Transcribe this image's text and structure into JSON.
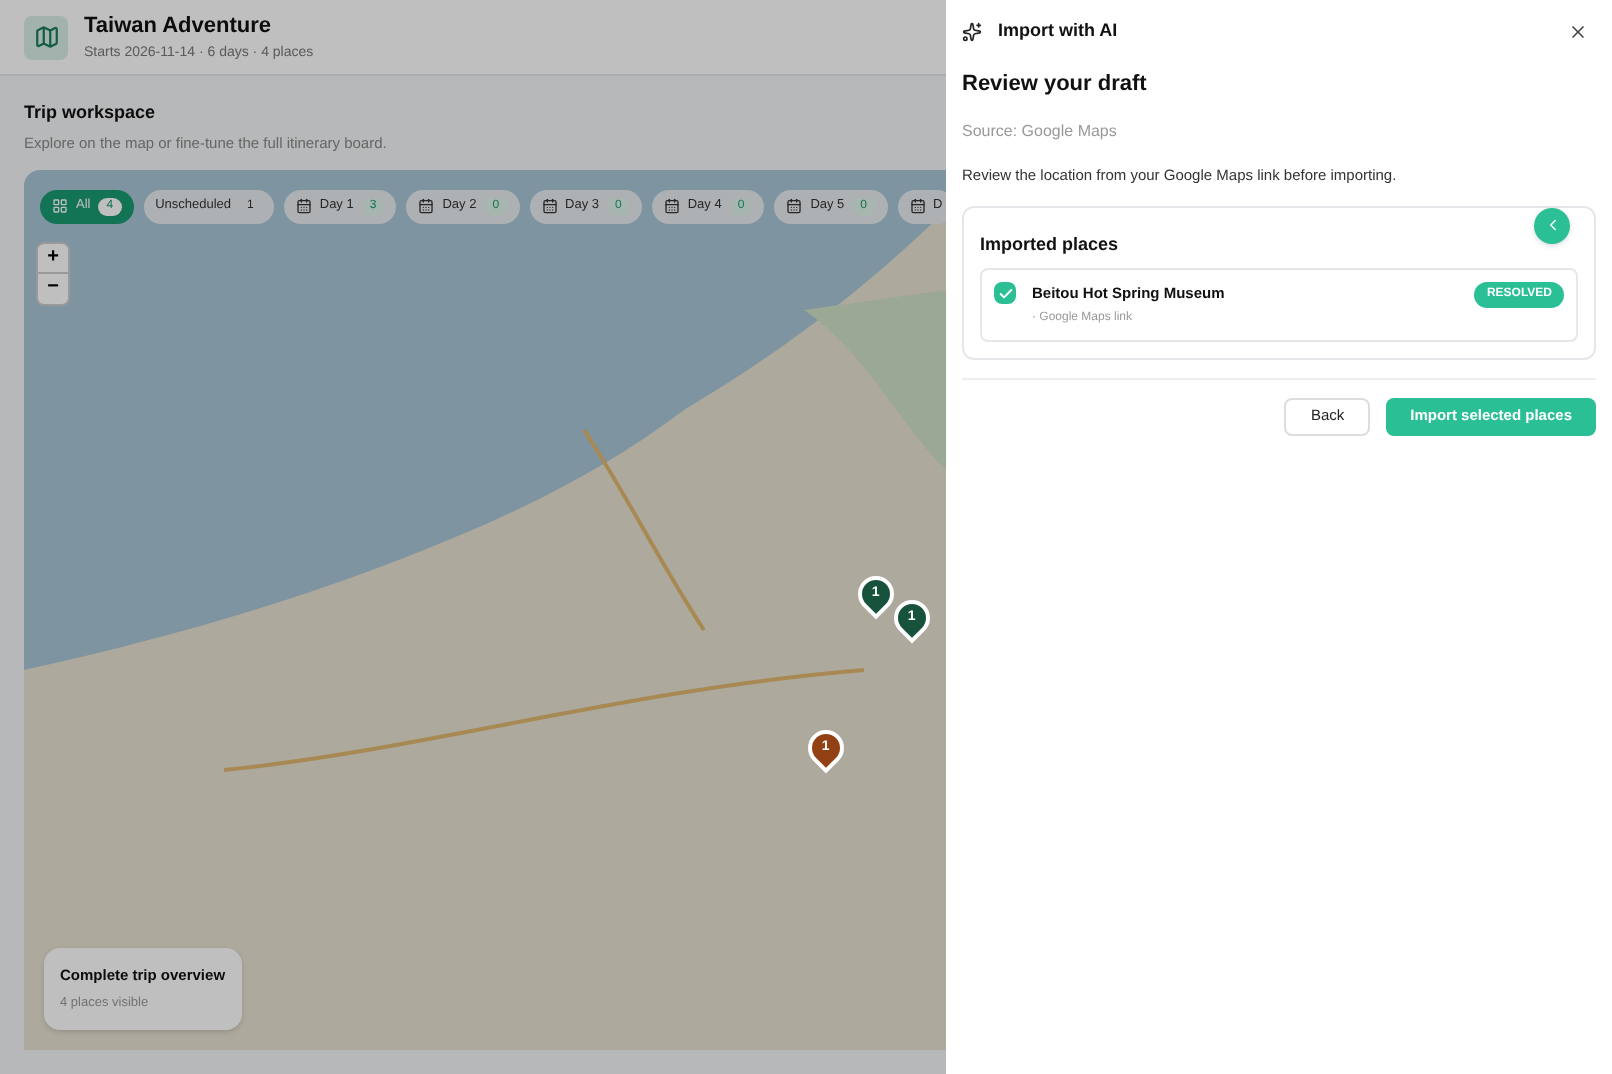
{
  "header": {
    "title": "Taiwan Adventure",
    "subtitle": "Starts 2026-11-14 · 6 days · 4 places"
  },
  "workspace": {
    "title": "Trip workspace",
    "subtitle": "Explore on the map or fine-tune the full itinerary board."
  },
  "filters": [
    {
      "kind": "all",
      "label": "All",
      "count": "4",
      "selected": true
    },
    {
      "kind": "unscheduled",
      "label": "Unscheduled",
      "count": "1",
      "selected": false
    },
    {
      "kind": "day",
      "label": "Day 1",
      "count": "3",
      "selected": false
    },
    {
      "kind": "day",
      "label": "Day 2",
      "count": "0",
      "selected": false
    },
    {
      "kind": "day",
      "label": "Day 3",
      "count": "0",
      "selected": false
    },
    {
      "kind": "day",
      "label": "Day 4",
      "count": "0",
      "selected": false
    },
    {
      "kind": "day",
      "label": "Day 5",
      "count": "0",
      "selected": false
    },
    {
      "kind": "day",
      "label": "D",
      "selected": false
    }
  ],
  "map": {
    "zoom_in": "+",
    "zoom_out": "−",
    "pins": [
      {
        "label": "1",
        "color": "#17533c"
      },
      {
        "label": "1",
        "color": "#17533c"
      },
      {
        "label": "1",
        "color": "#924114"
      }
    ]
  },
  "overview": {
    "title": "Complete trip overview",
    "subtitle": "4 places visible"
  },
  "drawer": {
    "title": "Import with AI",
    "heading": "Review your draft",
    "source": "Source: Google Maps",
    "description": "Review the location from your Google Maps link before importing.",
    "section_title": "Imported places",
    "places": [
      {
        "name": "Beitou Hot Spring Museum",
        "source": "· Google Maps link",
        "status": "RESOLVED",
        "checked": true
      }
    ],
    "back": "Back",
    "import": "Import selected places"
  }
}
